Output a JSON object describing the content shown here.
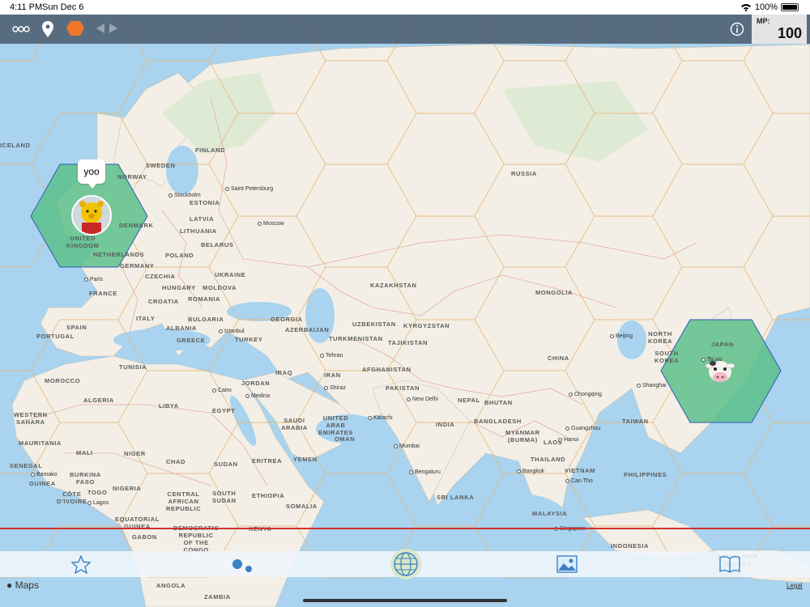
{
  "status_bar": {
    "time": "4:11 PM",
    "date": "Sun Dec 6",
    "battery": "100%"
  },
  "toolbar": {
    "icons": [
      "more-icon",
      "location-pin-icon",
      "hexagon-icon",
      "arrows-icon",
      "info-icon"
    ],
    "mp_label": "MP:",
    "mp_value": "100"
  },
  "map": {
    "bubble_text": "yoo",
    "colors": {
      "water": "#a9d3ee",
      "land": "#f3efe6",
      "hex_line": "#e8b77a",
      "hex_fill": "#5cc08a",
      "border": "#e8a9a9",
      "redline": "#d0312d"
    },
    "country_labels": [
      {
        "name": "FINLAND"
      },
      {
        "name": "SWEDEN"
      },
      {
        "name": "NORWAY"
      },
      {
        "name": "ESTONIA"
      },
      {
        "name": "LATVIA"
      },
      {
        "name": "LITHUANIA"
      },
      {
        "name": "DENMARK"
      },
      {
        "name": "BELARUS"
      },
      {
        "name": "POLAND"
      },
      {
        "name": "NETHERLANDS"
      },
      {
        "name": "GERMANY"
      },
      {
        "name": "CZECHIA"
      },
      {
        "name": "UKRAINE"
      },
      {
        "name": "HUNGARY"
      },
      {
        "name": "MOLDOVA"
      },
      {
        "name": "FRANCE"
      },
      {
        "name": "ROMANIA"
      },
      {
        "name": "CROATIA"
      },
      {
        "name": "BULGARIA"
      },
      {
        "name": "ITALY"
      },
      {
        "name": "ALBANIA"
      },
      {
        "name": "GREECE"
      },
      {
        "name": "SPAIN"
      },
      {
        "name": "PORTUGAL"
      },
      {
        "name": "TURKEY"
      },
      {
        "name": "GEORGIA"
      },
      {
        "name": "AZERBAIJAN"
      },
      {
        "name": "RUSSIA"
      },
      {
        "name": "KAZAKHSTAN"
      },
      {
        "name": "MONGOLIA"
      },
      {
        "name": "UZBEKISTAN"
      },
      {
        "name": "KYRGYZSTAN"
      },
      {
        "name": "TURKMENISTAN"
      },
      {
        "name": "TAJIKISTAN"
      },
      {
        "name": "CHINA"
      },
      {
        "name": "NORTH KOREA"
      },
      {
        "name": "SOUTH KOREA"
      },
      {
        "name": "JAPAN"
      },
      {
        "name": "IRAQ"
      },
      {
        "name": "IRAN"
      },
      {
        "name": "AFGHANISTAN"
      },
      {
        "name": "PAKISTAN"
      },
      {
        "name": "NEPAL"
      },
      {
        "name": "BHUTAN"
      },
      {
        "name": "INDIA"
      },
      {
        "name": "BANGLADESH"
      },
      {
        "name": "MYANMAR (BURMA)"
      },
      {
        "name": "LAOS"
      },
      {
        "name": "THAILAND"
      },
      {
        "name": "VIETNAM"
      },
      {
        "name": "TAIWAN"
      },
      {
        "name": "PHILIPPINES"
      },
      {
        "name": "SRI LANKA"
      },
      {
        "name": "MALAYSIA"
      },
      {
        "name": "INDONESIA"
      },
      {
        "name": "JORDAN"
      },
      {
        "name": "SAUDI ARABIA"
      },
      {
        "name": "UNITED ARAB EMIRATES"
      },
      {
        "name": "OMAN"
      },
      {
        "name": "YEMEN"
      },
      {
        "name": "EGYPT"
      },
      {
        "name": "LIBYA"
      },
      {
        "name": "TUNISIA"
      },
      {
        "name": "MOROCCO"
      },
      {
        "name": "ALGERIA"
      },
      {
        "name": "WESTERN SAHARA"
      },
      {
        "name": "MAURITANIA"
      },
      {
        "name": "MALI"
      },
      {
        "name": "NIGER"
      },
      {
        "name": "CHAD"
      },
      {
        "name": "SUDAN"
      },
      {
        "name": "ERITREA"
      },
      {
        "name": "ETHIOPIA"
      },
      {
        "name": "SOUTH SUDAN"
      },
      {
        "name": "SOMALIA"
      },
      {
        "name": "SENEGAL"
      },
      {
        "name": "GUINEA"
      },
      {
        "name": "BURKINA FASO"
      },
      {
        "name": "CÔTE D'IVOIRE"
      },
      {
        "name": "TOGO"
      },
      {
        "name": "NIGERIA"
      },
      {
        "name": "CENTRAL AFRICAN REPUBLIC"
      },
      {
        "name": "EQUATORIAL GUINEA"
      },
      {
        "name": "GABON"
      },
      {
        "name": "DEMOCRATIC REPUBLIC OF THE CONGO"
      },
      {
        "name": "KENYA"
      },
      {
        "name": "ANGOLA"
      },
      {
        "name": "ZAMBIA"
      },
      {
        "name": "UNITED KINGDOM"
      },
      {
        "name": "ICELAND"
      },
      {
        "name": "PAPUA NEW GUINEA"
      }
    ],
    "city_labels": [
      "Stockholm",
      "Saint Petersburg",
      "Moscow",
      "Paris",
      "Istanbul",
      "Tehran",
      "Shiraz",
      "Cairo",
      "Medina",
      "Karachi",
      "New Delhi",
      "Mumbai",
      "Bengaluru",
      "Bamako",
      "Lagos",
      "Beijing",
      "Tokyo",
      "Shanghai",
      "Chongqing",
      "Guangzhou",
      "Hanoi",
      "Bangkok",
      "Can Tho",
      "Singapore"
    ]
  },
  "tabbar": {
    "items": [
      "favorites",
      "nearby",
      "world",
      "gallery",
      "guide"
    ]
  },
  "footer": {
    "maps": "Maps",
    "legal": "Legal"
  }
}
